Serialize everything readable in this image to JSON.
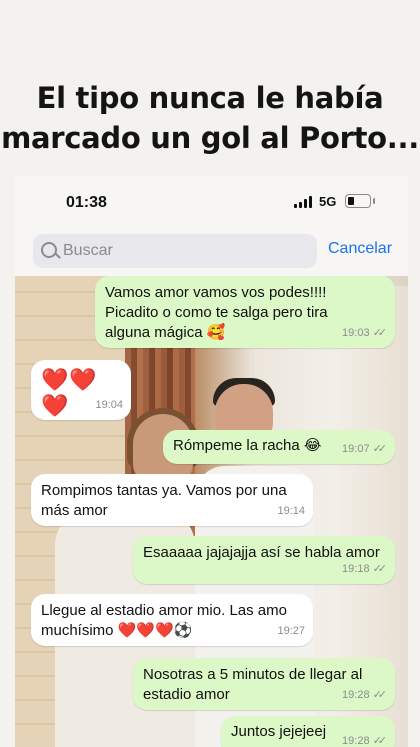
{
  "headline": {
    "line1": "El tipo nunca le había",
    "line2": "marcado un gol al Porto..."
  },
  "status_bar": {
    "time": "01:38",
    "network": "5G",
    "battery_level": 0.3
  },
  "search": {
    "placeholder": "Buscar",
    "cancel_label": "Cancelar"
  },
  "messages": [
    {
      "dir": "out",
      "text": "Vamos amor vamos vos podes!!!!\nPicadito o como te salga pero tira\nalguna mágica 🥰",
      "time": "19:03",
      "ticks": "✓✓"
    },
    {
      "dir": "in",
      "text": "❤️❤️❤️",
      "time": "19:04"
    },
    {
      "dir": "out",
      "text": "Rómpeme la racha 😂",
      "time": "19:07",
      "ticks": "✓✓"
    },
    {
      "dir": "in",
      "text": "Rompimos tantas ya. Vamos por una\nmás amor",
      "time": "19:14"
    },
    {
      "dir": "out",
      "text": "Esaaaaa jajajajja así se habla amor",
      "time": "19:18",
      "ticks": "✓✓"
    },
    {
      "dir": "in",
      "text": "Llegue al estadio amor mio. Las amo\nmuchísimo ❤️❤️❤️⚽",
      "time": "19:27"
    },
    {
      "dir": "out",
      "text": "Nosotras a 5 minutos de llegar al\nestadio amor",
      "time": "19:28",
      "ticks": "✓✓"
    },
    {
      "dir": "out",
      "text": "Juntos jejejeej",
      "time": "19:28",
      "ticks": "✓✓"
    }
  ],
  "colors": {
    "outgoing_bubble": "#dcf8c6",
    "incoming_bubble": "#ffffff",
    "accent": "#1a73e8"
  }
}
